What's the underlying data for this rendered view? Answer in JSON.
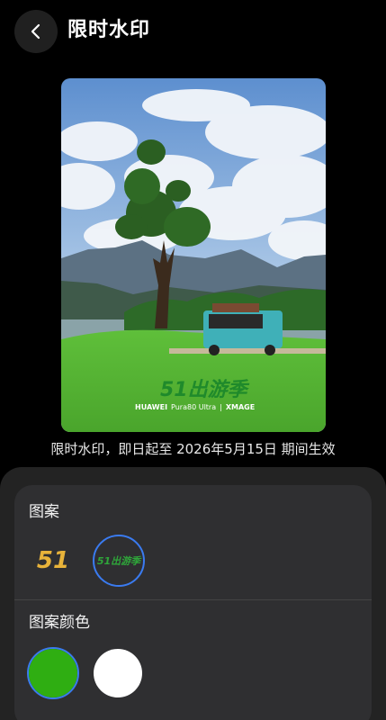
{
  "header": {
    "title": "限时水印",
    "back_icon": "chevron-left-icon"
  },
  "photo": {
    "watermark_logo": "51出游季",
    "camera_brand": "HUAWEI",
    "camera_model": "Pura80 Ultra",
    "separator": "|",
    "camera_tag": "XMAGE"
  },
  "caption": "限时水印，即日起至 2026年5月15日 期间生效",
  "panel": {
    "pattern_label": "图案",
    "patterns": [
      {
        "name": "51",
        "style": "gold-51",
        "selected": false
      },
      {
        "name": "51出游季",
        "style": "green-script",
        "selected": true
      }
    ],
    "color_label": "图案颜色",
    "colors": [
      {
        "value": "#2fae12",
        "selected": true
      },
      {
        "value": "#ffffff",
        "selected": false
      }
    ],
    "accent": "#3a7bf0"
  }
}
